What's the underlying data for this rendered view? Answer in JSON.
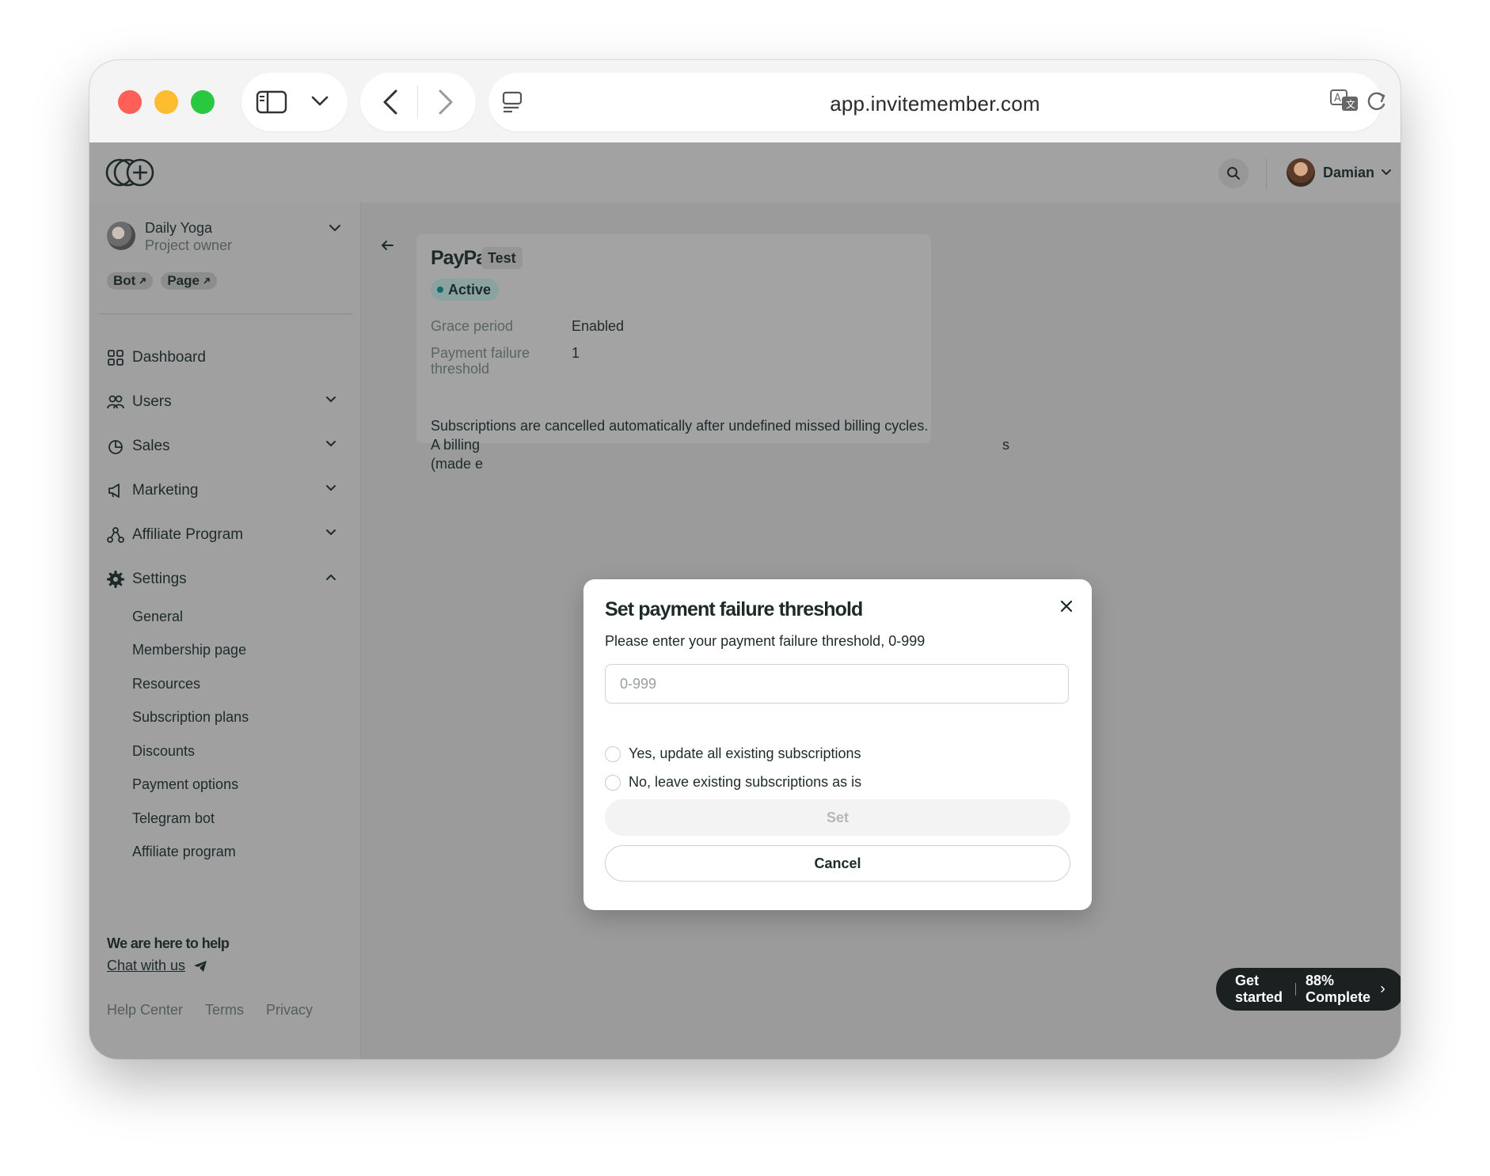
{
  "browser": {
    "url": "app.invitemember.com"
  },
  "topbar": {
    "user_name": "Damian"
  },
  "sidebar": {
    "project_name": "Daily Yoga",
    "project_role": "Project owner",
    "tags": [
      "Bot",
      "Page"
    ],
    "nav": [
      {
        "label": "Dashboard",
        "icon": "grid-icon"
      },
      {
        "label": "Users",
        "icon": "users-icon"
      },
      {
        "label": "Sales",
        "icon": "pie-chart-icon"
      },
      {
        "label": "Marketing",
        "icon": "megaphone-icon"
      },
      {
        "label": "Affiliate Program",
        "icon": "affiliate-icon"
      },
      {
        "label": "Settings",
        "icon": "gear-icon"
      }
    ],
    "settings_items": [
      "General",
      "Membership page",
      "Resources",
      "Subscription plans",
      "Discounts",
      "Payment options",
      "Telegram bot",
      "Affiliate program"
    ],
    "help_title": "We are here to help",
    "chat_link": "Chat with us",
    "footer": [
      "Help Center",
      "Terms",
      "Privacy"
    ]
  },
  "card": {
    "provider": "PayPal",
    "mode_badge": "Test",
    "status": "Active",
    "grace_label": "Grace period",
    "grace_value": "Enabled",
    "threshold_label": "Payment failure threshold",
    "threshold_value": "1",
    "desc_line1": "Subscriptions are cancelled automatically after undefined missed billing cycles.",
    "desc_line2_start": "A billing",
    "desc_line2_end": "s",
    "desc_line3_start": "(made e"
  },
  "get_started": {
    "label": "Get started",
    "progress": "88% Complete"
  },
  "modal": {
    "title": "Set payment failure threshold",
    "description": "Please enter your payment failure threshold, 0-999",
    "input_placeholder": "0-999",
    "input_value": "",
    "option_yes": "Yes, update all existing subscriptions",
    "option_no": "No, leave existing subscriptions as is",
    "set_label": "Set",
    "cancel_label": "Cancel"
  }
}
